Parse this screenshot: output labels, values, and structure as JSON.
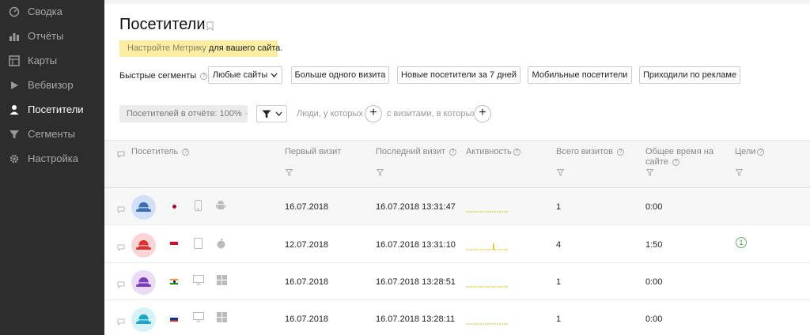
{
  "sidebar": {
    "items": [
      {
        "label": "Сводка",
        "icon": "dashboard-icon",
        "active": false
      },
      {
        "label": "Отчёты",
        "icon": "bar-chart-icon",
        "active": false
      },
      {
        "label": "Карты",
        "icon": "map-icon",
        "active": false
      },
      {
        "label": "Вебвизор",
        "icon": "play-icon",
        "active": false
      },
      {
        "label": "Посетители",
        "icon": "person-icon",
        "active": true
      },
      {
        "label": "Сегменты",
        "icon": "funnel-icon",
        "active": false
      },
      {
        "label": "Настройка",
        "icon": "gear-icon",
        "active": false
      }
    ]
  },
  "page": {
    "title": "Посетители",
    "banner_link": "Настройте Метрику",
    "banner_text": " для вашего сайта."
  },
  "segments": {
    "label": "Быстрые сегменты",
    "sites_dropdown": "Любые сайты",
    "buttons": [
      "Больше одного визита",
      "Новые посетители за 7 дней",
      "Мобильные посетители",
      "Приходили по рекламе"
    ]
  },
  "filters": {
    "visitors_in_report": "Посетителей в отчёте: 100%",
    "people_who": "Люди, у которых",
    "with_visits_where": "с визитами, в которых"
  },
  "table": {
    "columns": {
      "visitor": "Посетитель",
      "first_visit": "Первый визит",
      "last_visit": "Последний визит",
      "activity": "Активность",
      "total_visits": "Всего визитов",
      "total_time_line1": "Общее время на",
      "total_time_line2": "сайте",
      "goals": "Цели"
    },
    "rows": [
      {
        "avatar_color": "#cfe0f8",
        "hat_color": "#3c6eb0",
        "flag": "jp",
        "device": "phone",
        "os": "android",
        "first_visit": "16.07.2018",
        "last_visit": "16.07.2018 13:31:47",
        "visits": "1",
        "time": "0:00",
        "goals": "",
        "activity_spike": false
      },
      {
        "avatar_color": "#fbd5d5",
        "hat_color": "#d93333",
        "flag": "id",
        "device": "tablet",
        "os": "apple",
        "first_visit": "12.07.2018",
        "last_visit": "16.07.2018 13:31:10",
        "visits": "4",
        "time": "1:50",
        "goals": "1",
        "activity_spike": true
      },
      {
        "avatar_color": "#eadcf6",
        "hat_color": "#7a3fb8",
        "flag": "in",
        "device": "desktop",
        "os": "windows",
        "first_visit": "16.07.2018",
        "last_visit": "16.07.2018 13:28:51",
        "visits": "1",
        "time": "0:00",
        "goals": "",
        "activity_spike": false
      },
      {
        "avatar_color": "#d6f1f7",
        "hat_color": "#1aa6c4",
        "flag": "ru",
        "device": "desktop",
        "os": "windows",
        "first_visit": "16.07.2018",
        "last_visit": "16.07.2018 13:28:11",
        "visits": "1",
        "time": "0:00",
        "goals": "",
        "activity_spike": false
      }
    ]
  }
}
